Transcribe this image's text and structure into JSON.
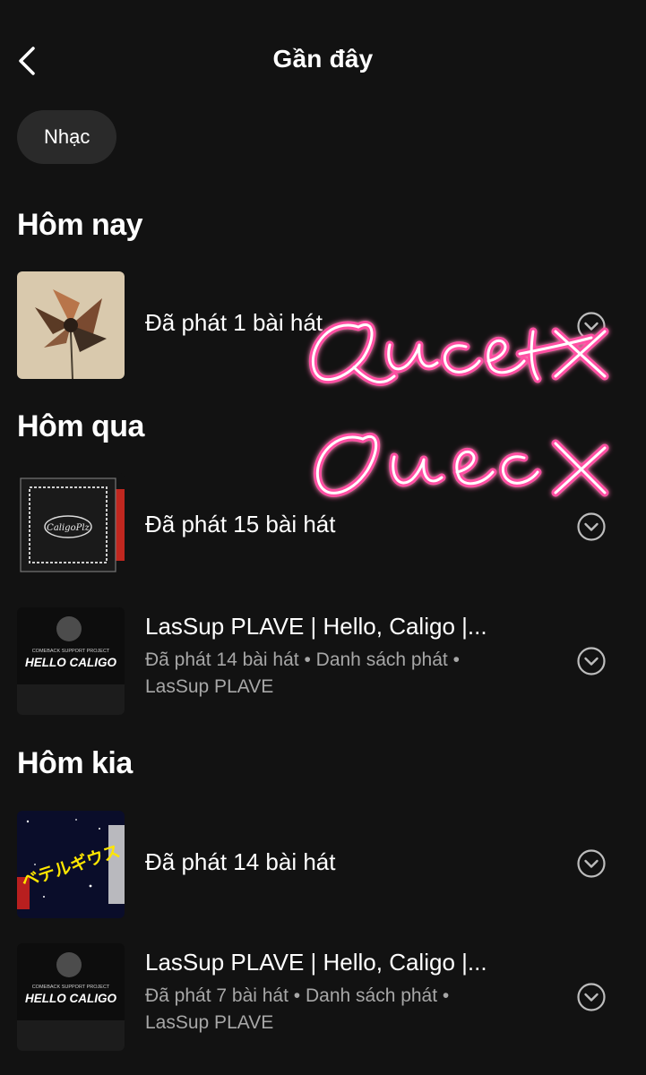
{
  "header": {
    "title": "Gần đây",
    "back_icon": "chevron-left-icon"
  },
  "filters": {
    "chip_label": "Nhạc"
  },
  "sections": [
    {
      "title": "Hôm nay",
      "items": [
        {
          "title": "Đã phát 1 bài hát"
        }
      ]
    },
    {
      "title": "Hôm qua",
      "items": [
        {
          "title": "Đã phát 15 bài hát"
        },
        {
          "title": "LasSup PLAVE | Hello, Caligo |...",
          "sub_line1": "Đã phát 14 bài hát • Danh sách phát •",
          "sub_line2": "LasSup PLAVE",
          "art_text": "HELLO CALIGO",
          "art_small": "COMEBACK SUPPORT PROJECT"
        }
      ]
    },
    {
      "title": "Hôm kia",
      "items": [
        {
          "title": "Đã phát 14 bài hát",
          "art_text": "ベテルギウス"
        },
        {
          "title": "LasSup PLAVE | Hello, Caligo |...",
          "sub_line1": "Đã phát 7 bài hát • Danh sách phát •",
          "sub_line2": "LasSup PLAVE",
          "art_text": "HELLO CALIGO",
          "art_small": "COMEBACK SUPPORT PROJECT"
        }
      ]
    }
  ],
  "overlay": {
    "handwriting": "Quest Check",
    "color": "#ff4fa3"
  },
  "colors": {
    "background": "#121212",
    "chip_bg": "#2a2a2a",
    "secondary_text": "#a7a7a7"
  }
}
